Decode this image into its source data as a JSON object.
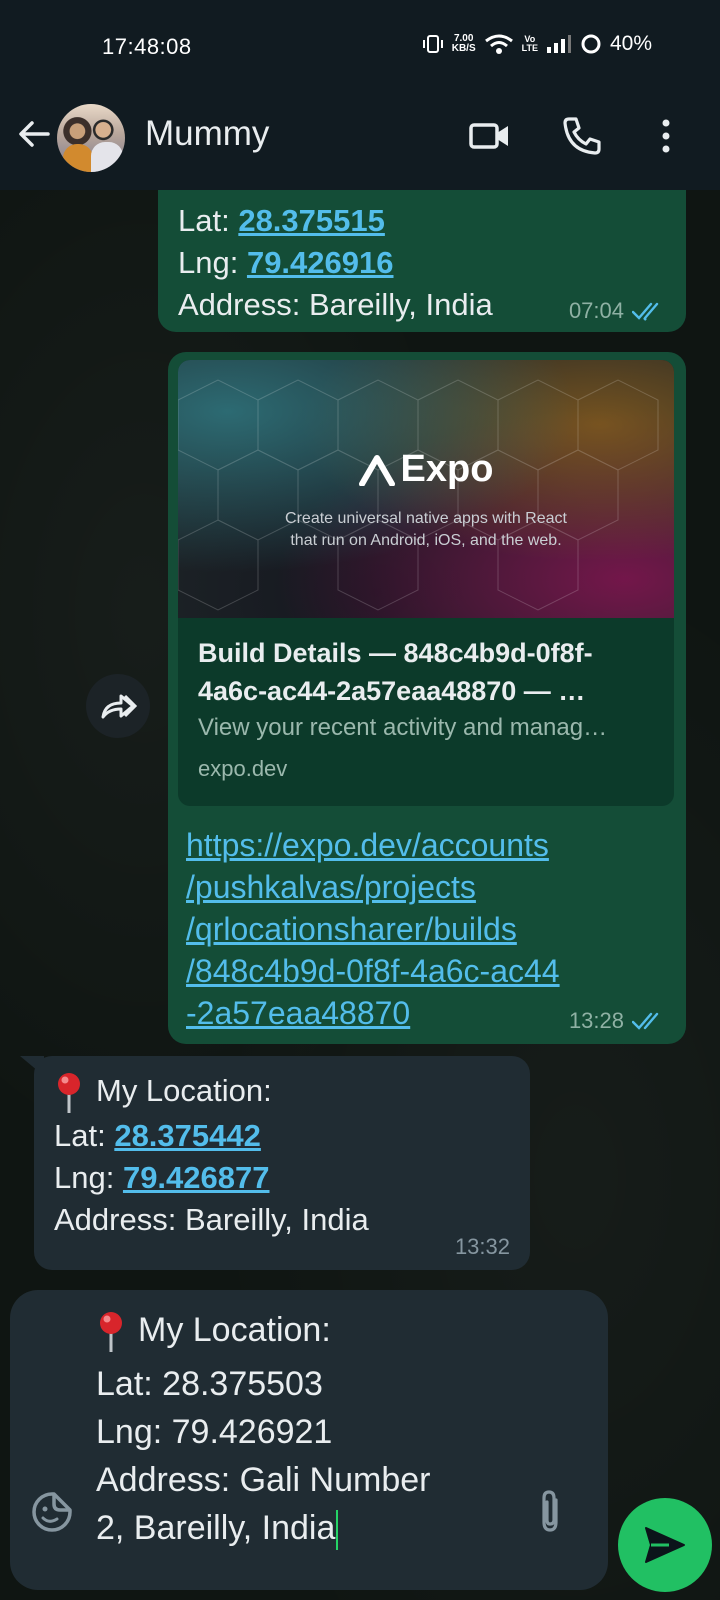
{
  "status_bar": {
    "time": "17:48:08",
    "net_speed_value": "7.00",
    "net_speed_unit": "KB/S",
    "volte_top": "Vo",
    "volte_bottom": "LTE",
    "battery": "40%"
  },
  "header": {
    "contact_name": "Mummy"
  },
  "messages": {
    "m1": {
      "lat_label": "Lat: ",
      "lat_value": "28.375515",
      "lng_label": "Lng: ",
      "lng_value": "79.426916",
      "address": "Address: Bareilly, India",
      "time": "07:04"
    },
    "m2": {
      "preview_logo_text": "Expo",
      "preview_tagline_1": "Create universal native apps with React",
      "preview_tagline_2": "that run on Android, iOS, and the web.",
      "preview_title_1": "Build Details — 848c4b9d-0f8f-",
      "preview_title_2": "4a6c-ac44-2a57eaa48870 — …",
      "preview_description": "View your recent activity and manag…",
      "preview_domain": "expo.dev",
      "url_lines": [
        "https://expo.dev/accounts",
        "/pushkalvas/projects",
        "/qrlocationsharer/builds",
        "/848c4b9d-0f8f-4a6c-ac44",
        "-2a57eaa48870"
      ],
      "time": "13:28"
    },
    "m3": {
      "heading": "My Location:",
      "lat_label": "Lat: ",
      "lat_value": "28.375442",
      "lng_label": "Lng: ",
      "lng_value": "79.426877",
      "address": "Address: Bareilly, India",
      "time": "13:32"
    }
  },
  "composer": {
    "lines": [
      "My Location:",
      "Lat: 28.375503",
      "Lng: 79.426921",
      "Address: Gali Number",
      "2, Bareilly, India"
    ]
  },
  "colors": {
    "outgoing_bubble": "#144d37",
    "incoming_bubble": "#202c33",
    "link": "#53bdeb",
    "send_button": "#21c063",
    "read_tick": "#53bdeb"
  },
  "icons": {
    "back": "back-arrow-icon",
    "video": "video-call-icon",
    "call": "phone-icon",
    "menu": "more-vert-icon",
    "forward": "forward-icon",
    "sticker": "sticker-icon",
    "attach": "paperclip-icon",
    "send": "send-icon",
    "pin": "round-pushpin-icon",
    "ticks": "double-check-icon"
  }
}
